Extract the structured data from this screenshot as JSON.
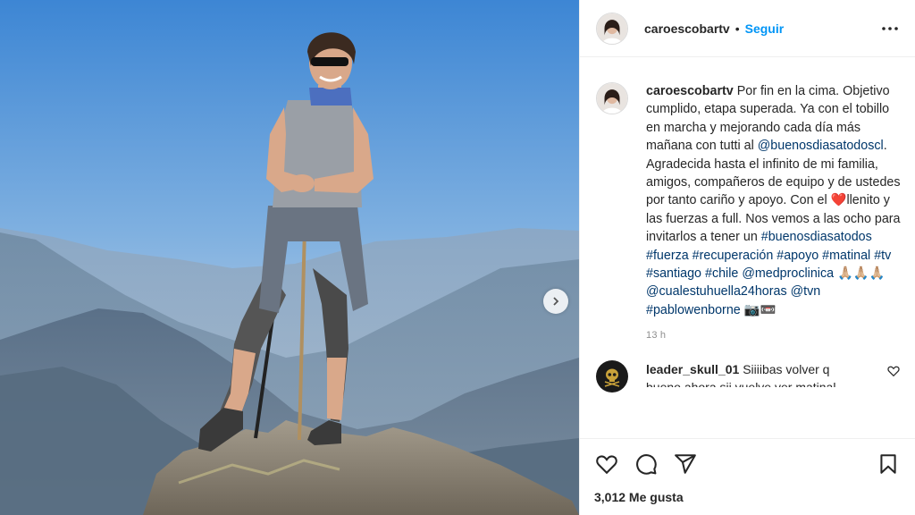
{
  "post": {
    "username": "caroescobartv",
    "follow_label": "Seguir",
    "dot": "•",
    "caption": {
      "username": "caroescobartv",
      "segments": [
        {
          "t": "Por fin en la cima. Objetivo cumplido, etapa superada. Ya con el tobillo en marcha y mejorando cada día más mañana con tutti al ",
          "link": false
        },
        {
          "t": "@buenosdiasatodoscl",
          "link": true
        },
        {
          "t": ". Agradecida hasta el infinito de mi familia, amigos, compañeros de equipo y de ustedes por tanto cariño y apoyo. Con el ",
          "link": false
        },
        {
          "t": "❤️",
          "link": false,
          "emoji": true
        },
        {
          "t": "llenito y las fuerzas a full. Nos vemos a las ocho para invitarlos a tener un ",
          "link": false
        },
        {
          "t": "#buenosdiasatodos",
          "link": true
        },
        {
          "t": " ",
          "link": false
        },
        {
          "t": "#fuerza",
          "link": true
        },
        {
          "t": " ",
          "link": false
        },
        {
          "t": "#recuperación",
          "link": true
        },
        {
          "t": " ",
          "link": false
        },
        {
          "t": "#apoyo",
          "link": true
        },
        {
          "t": " ",
          "link": false
        },
        {
          "t": "#matinal",
          "link": true
        },
        {
          "t": " ",
          "link": false
        },
        {
          "t": "#tv",
          "link": true
        },
        {
          "t": " ",
          "link": false
        },
        {
          "t": "#santiago",
          "link": true
        },
        {
          "t": " ",
          "link": false
        },
        {
          "t": "#chile",
          "link": true
        },
        {
          "t": " ",
          "link": false
        },
        {
          "t": "@medproclinica",
          "link": true
        },
        {
          "t": " 🙏🏼🙏🏼🙏🏼 ",
          "link": false,
          "emoji": true
        },
        {
          "t": "@cualestuhuella24horas",
          "link": true
        },
        {
          "t": " ",
          "link": false
        },
        {
          "t": "@tvn",
          "link": true
        },
        {
          "t": " ",
          "link": false
        },
        {
          "t": "#pablowenborne",
          "link": true
        },
        {
          "t": " 📷📼",
          "link": false,
          "emoji": true
        }
      ]
    },
    "time_ago": "13 h",
    "comment": {
      "username": "leader_skull_01",
      "text": "Siiiibas volver q",
      "overflow_text": "bueno ahora sii vuelve ver matinal"
    },
    "likes_label": "3,012 Me gusta"
  },
  "icons": {
    "more": "more-options-icon",
    "next": "chevron-right-icon",
    "like": "heart-icon",
    "comment": "comment-icon",
    "share": "share-icon",
    "save": "bookmark-icon",
    "comment_like": "heart-small-icon"
  },
  "colors": {
    "link": "#00376b",
    "follow": "#0095f6",
    "sky": "#4a8fd6",
    "muted": "#8e8e8e"
  }
}
